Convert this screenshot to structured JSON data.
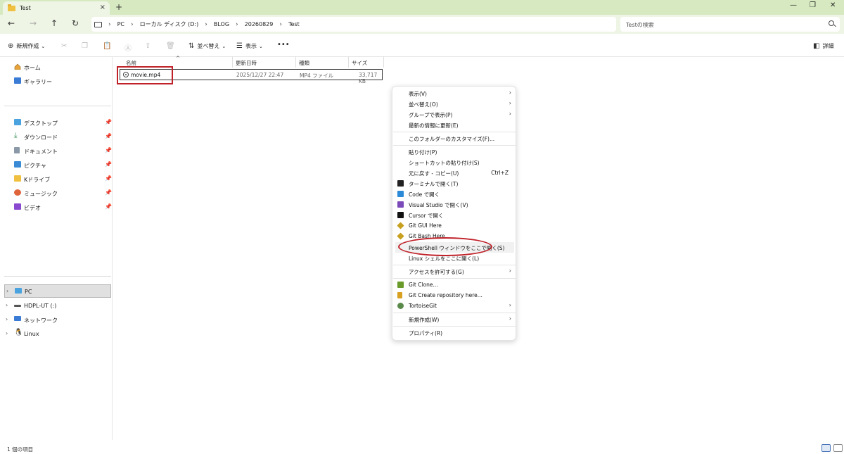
{
  "window": {
    "tab_title": "Test",
    "tab_close": "×",
    "new_tab": "+",
    "minimize": "—",
    "maximize": "❐",
    "close": "✕"
  },
  "nav": {
    "back": "←",
    "forward": "→",
    "up": "↑",
    "refresh": "↻"
  },
  "breadcrumb": [
    "PC",
    "ローカル ディスク (D:)",
    "BLOG",
    "20260829",
    "Test"
  ],
  "search": {
    "placeholder": "Testの検索"
  },
  "toolbar": {
    "new_label": "新規作成",
    "sort_label": "並べ替え",
    "view_label": "表示",
    "more_label": "•••",
    "details_label": "詳細"
  },
  "sidebar": {
    "top": [
      {
        "label": "ホーム",
        "icon": "home-icon"
      },
      {
        "label": "ギャラリー",
        "icon": "gallery-icon"
      }
    ],
    "pinned": [
      {
        "label": "デスクトップ",
        "icon": "desktop-icon"
      },
      {
        "label": "ダウンロード",
        "icon": "download-icon"
      },
      {
        "label": "ドキュメント",
        "icon": "document-icon"
      },
      {
        "label": "ピクチャ",
        "icon": "pictures-icon"
      },
      {
        "label": "Kドライブ",
        "icon": "folder-icon"
      },
      {
        "label": "ミュージック",
        "icon": "music-icon"
      },
      {
        "label": "ビデオ",
        "icon": "video-icon"
      }
    ],
    "drives": [
      {
        "label": "PC",
        "icon": "pc-icon"
      },
      {
        "label": "HDPL-UT (:)",
        "icon": "drive-icon"
      },
      {
        "label": "ネットワーク",
        "icon": "network-icon"
      },
      {
        "label": "Linux",
        "icon": "linux-icon"
      }
    ]
  },
  "columns": {
    "name": "名前",
    "modified": "更新日時",
    "type": "種類",
    "size": "サイズ"
  },
  "files": [
    {
      "name": "movie.mp4",
      "modified": "2025/12/27 22:47",
      "type": "MP4 ファイル",
      "size": "33,717 KB"
    }
  ],
  "context_menu": {
    "items": [
      {
        "label": "表示(V)",
        "arrow": "›"
      },
      {
        "label": "並べ替え(O)",
        "arrow": "›"
      },
      {
        "label": "グループで表示(P)",
        "arrow": "›"
      },
      {
        "label": "最新の情報に更新(E)"
      },
      {
        "label": "このフォルダーのカスタマイズ(F)..."
      },
      {
        "label": "貼り付け(P)"
      },
      {
        "label": "ショートカットの貼り付け(S)"
      },
      {
        "label": "元に戻す - コピー(U)",
        "shortcut": "Ctrl+Z"
      },
      {
        "label": "ターミナルで開く(T)",
        "icon": "terminal-icon"
      },
      {
        "label": "Code で開く",
        "icon": "vscode-icon"
      },
      {
        "label": "Visual Studio で開く(V)",
        "icon": "visual-studio-icon"
      },
      {
        "label": "Cursor で開く",
        "icon": "cursor-icon"
      },
      {
        "label": "Git GUI Here",
        "icon": "git-gui-icon"
      },
      {
        "label": "Git Bash Here",
        "icon": "git-bash-icon"
      },
      {
        "label": "PowerShell ウィンドウをここで開く(S)"
      },
      {
        "label": "Linux シェルをここに開く(L)"
      },
      {
        "label": "アクセスを許可する(G)",
        "arrow": "›"
      },
      {
        "label": "Git Clone...",
        "icon": "git-clone-icon"
      },
      {
        "label": "Git Create repository here...",
        "icon": "git-create-icon"
      },
      {
        "label": "TortoiseGit",
        "icon": "tortoisegit-icon",
        "arrow": "›"
      },
      {
        "label": "新規作成(W)",
        "arrow": "›"
      },
      {
        "label": "プロパティ(R)"
      }
    ]
  },
  "status": {
    "item_count": "1 個の項目"
  },
  "colors": {
    "titlebar": "#d7e9c0",
    "addressbar": "#eef5e4",
    "highlight": "#c0222a"
  }
}
